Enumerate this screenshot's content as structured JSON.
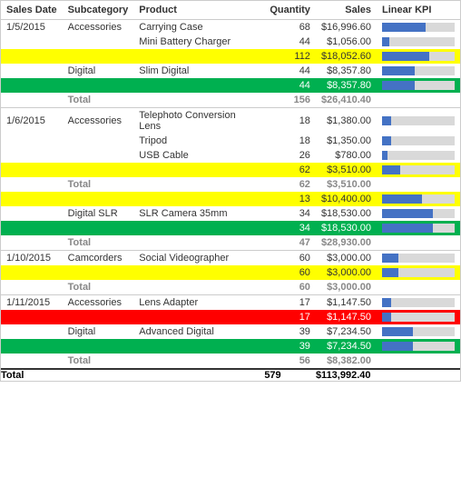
{
  "header": {
    "columns": [
      "Sales Date",
      "Subcategory",
      "Product",
      "Quantity",
      "Sales",
      "Linear KPI"
    ]
  },
  "rows": [
    {
      "date": "1/5/2015",
      "subcat": "Accessories",
      "product": "Carrying Case",
      "qty": "68",
      "sales": "$16,996.60",
      "kpi": 60,
      "highlight": "none"
    },
    {
      "date": "",
      "subcat": "",
      "product": "Mini Battery Charger",
      "qty": "44",
      "sales": "$1,056.00",
      "kpi": 10,
      "highlight": "none"
    },
    {
      "date": "",
      "subcat": "",
      "product": "",
      "qty": "112",
      "sales": "$18,052.60",
      "kpi": 65,
      "highlight": "yellow"
    },
    {
      "date": "",
      "subcat": "Digital",
      "product": "Slim Digital",
      "qty": "44",
      "sales": "$8,357.80",
      "kpi": 45,
      "highlight": "none"
    },
    {
      "date": "",
      "subcat": "",
      "product": "",
      "qty": "44",
      "sales": "$8,357.80",
      "kpi": 45,
      "highlight": "green"
    },
    {
      "date": "",
      "subcat": "Total",
      "product": "",
      "qty": "156",
      "sales": "$26,410.40",
      "kpi": 0,
      "highlight": "total"
    },
    {
      "date": "1/6/2015",
      "subcat": "Accessories",
      "product": "Telephoto Conversion Lens",
      "qty": "18",
      "sales": "$1,380.00",
      "kpi": 12,
      "highlight": "none"
    },
    {
      "date": "",
      "subcat": "",
      "product": "Tripod",
      "qty": "18",
      "sales": "$1,350.00",
      "kpi": 12,
      "highlight": "none"
    },
    {
      "date": "",
      "subcat": "",
      "product": "USB Cable",
      "qty": "26",
      "sales": "$780.00",
      "kpi": 8,
      "highlight": "none"
    },
    {
      "date": "",
      "subcat": "",
      "product": "",
      "qty": "62",
      "sales": "$3,510.00",
      "kpi": 25,
      "highlight": "yellow"
    },
    {
      "date": "",
      "subcat": "Total",
      "product": "",
      "qty": "62",
      "sales": "$3,510.00",
      "kpi": 0,
      "highlight": "total"
    },
    {
      "date": "",
      "subcat": "",
      "product": "",
      "qty": "13",
      "sales": "$10,400.00",
      "kpi": 55,
      "highlight": "yellow"
    },
    {
      "date": "",
      "subcat": "Digital SLR",
      "product": "SLR Camera 35mm",
      "qty": "34",
      "sales": "$18,530.00",
      "kpi": 70,
      "highlight": "none"
    },
    {
      "date": "",
      "subcat": "",
      "product": "",
      "qty": "34",
      "sales": "$18,530.00",
      "kpi": 70,
      "highlight": "green"
    },
    {
      "date": "",
      "subcat": "Total",
      "product": "",
      "qty": "47",
      "sales": "$28,930.00",
      "kpi": 0,
      "highlight": "total"
    },
    {
      "date": "1/10/2015",
      "subcat": "Camcorders",
      "product": "Social Videographer",
      "qty": "60",
      "sales": "$3,000.00",
      "kpi": 22,
      "highlight": "none"
    },
    {
      "date": "",
      "subcat": "",
      "product": "",
      "qty": "60",
      "sales": "$3,000.00",
      "kpi": 22,
      "highlight": "yellow"
    },
    {
      "date": "",
      "subcat": "Total",
      "product": "",
      "qty": "60",
      "sales": "$3,000.00",
      "kpi": 0,
      "highlight": "total"
    },
    {
      "date": "1/11/2015",
      "subcat": "Accessories",
      "product": "Lens Adapter",
      "qty": "17",
      "sales": "$1,147.50",
      "kpi": 12,
      "highlight": "none"
    },
    {
      "date": "",
      "subcat": "",
      "product": "",
      "qty": "17",
      "sales": "$1,147.50",
      "kpi": 12,
      "highlight": "red"
    },
    {
      "date": "",
      "subcat": "Digital",
      "product": "Advanced Digital",
      "qty": "39",
      "sales": "$7,234.50",
      "kpi": 42,
      "highlight": "none"
    },
    {
      "date": "",
      "subcat": "",
      "product": "",
      "qty": "39",
      "sales": "$7,234.50",
      "kpi": 42,
      "highlight": "green"
    },
    {
      "date": "",
      "subcat": "Total",
      "product": "",
      "qty": "56",
      "sales": "$8,382.00",
      "kpi": 0,
      "highlight": "total"
    }
  ],
  "grand_total": {
    "label": "Total",
    "qty": "579",
    "sales": "$113,992.40"
  }
}
